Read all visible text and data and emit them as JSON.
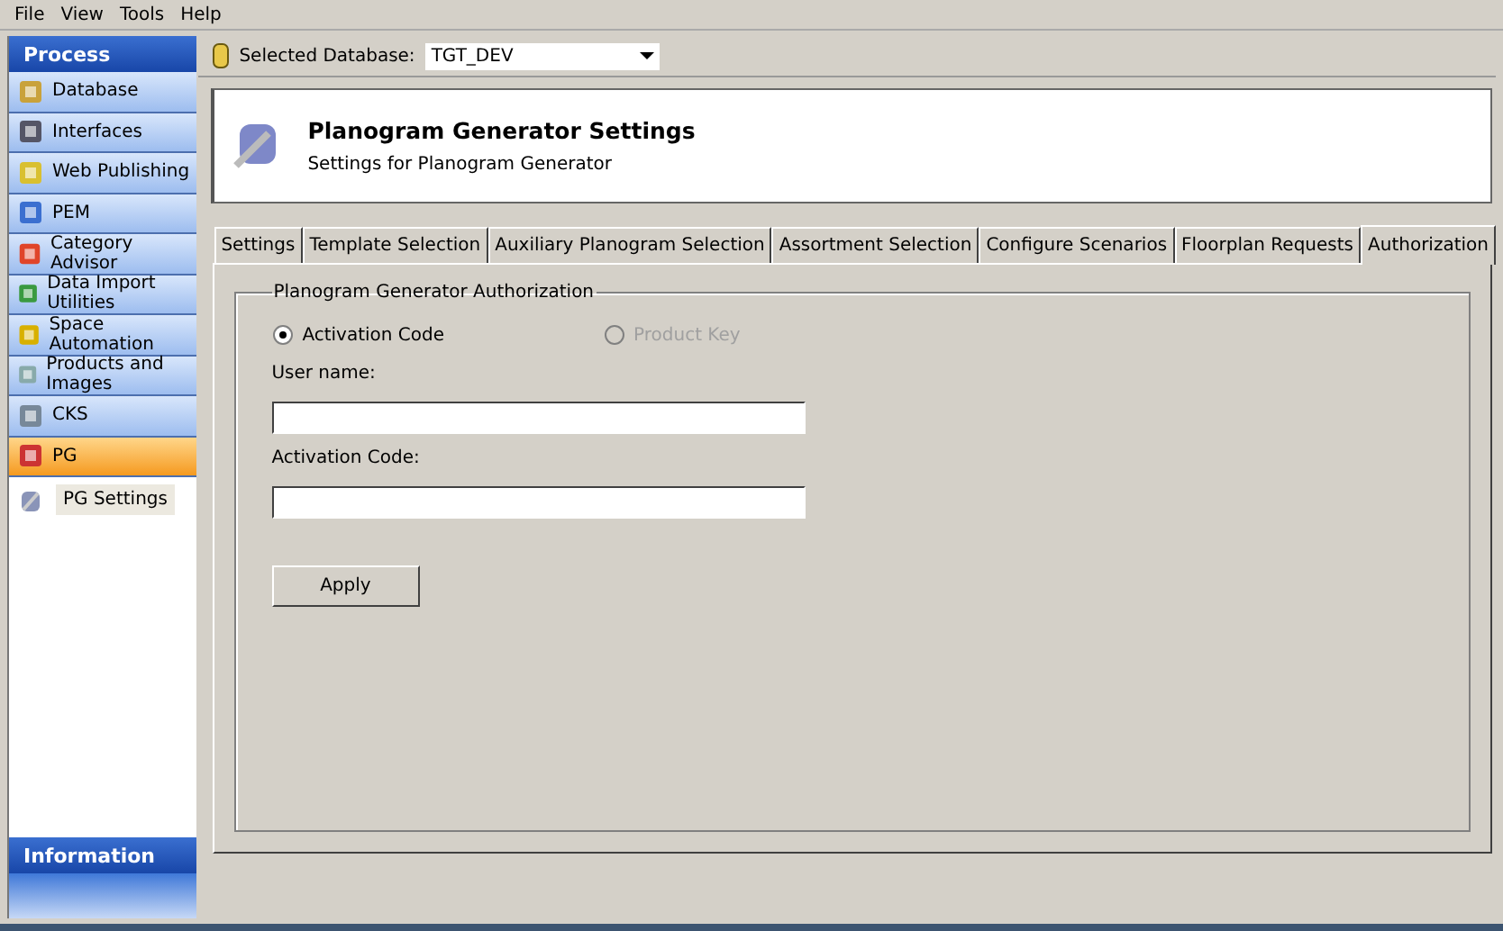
{
  "menu": [
    "File",
    "View",
    "Tools",
    "Help"
  ],
  "sidebar": {
    "title": "Process",
    "items": [
      {
        "label": "Database",
        "selected": false
      },
      {
        "label": "Interfaces",
        "selected": false
      },
      {
        "label": "Web Publishing",
        "selected": false
      },
      {
        "label": "PEM",
        "selected": false
      },
      {
        "label": "Category Advisor",
        "selected": false
      },
      {
        "label": "Data Import Utilities",
        "selected": false
      },
      {
        "label": "Space Automation",
        "selected": false
      },
      {
        "label": "Products and Images",
        "selected": false
      },
      {
        "label": "CKS",
        "selected": false
      },
      {
        "label": "PG",
        "selected": true
      }
    ],
    "sub_items": [
      {
        "label": "PG Settings",
        "selected": true
      }
    ],
    "info_title": "Information"
  },
  "database_bar": {
    "label": "Selected Database:",
    "value": "TGT_DEV"
  },
  "header": {
    "title": "Planogram Generator Settings",
    "subtitle": "Settings for Planogram Generator"
  },
  "tabs": [
    {
      "label": "Settings",
      "selected": false
    },
    {
      "label": "Template Selection",
      "selected": false
    },
    {
      "label": "Auxiliary Planogram Selection",
      "selected": false
    },
    {
      "label": "Assortment Selection",
      "selected": false
    },
    {
      "label": "Configure Scenarios",
      "selected": false
    },
    {
      "label": "Floorplan Requests",
      "selected": false
    },
    {
      "label": "Authorization",
      "selected": true
    }
  ],
  "group": {
    "title": "Planogram Generator Authorization",
    "radios": [
      {
        "label": "Activation Code",
        "selected": true,
        "disabled": false
      },
      {
        "label": "Product Key",
        "selected": false,
        "disabled": true
      }
    ],
    "fields": [
      {
        "label": "User name:"
      },
      {
        "label": "Activation Code:"
      }
    ],
    "button": "Apply"
  }
}
